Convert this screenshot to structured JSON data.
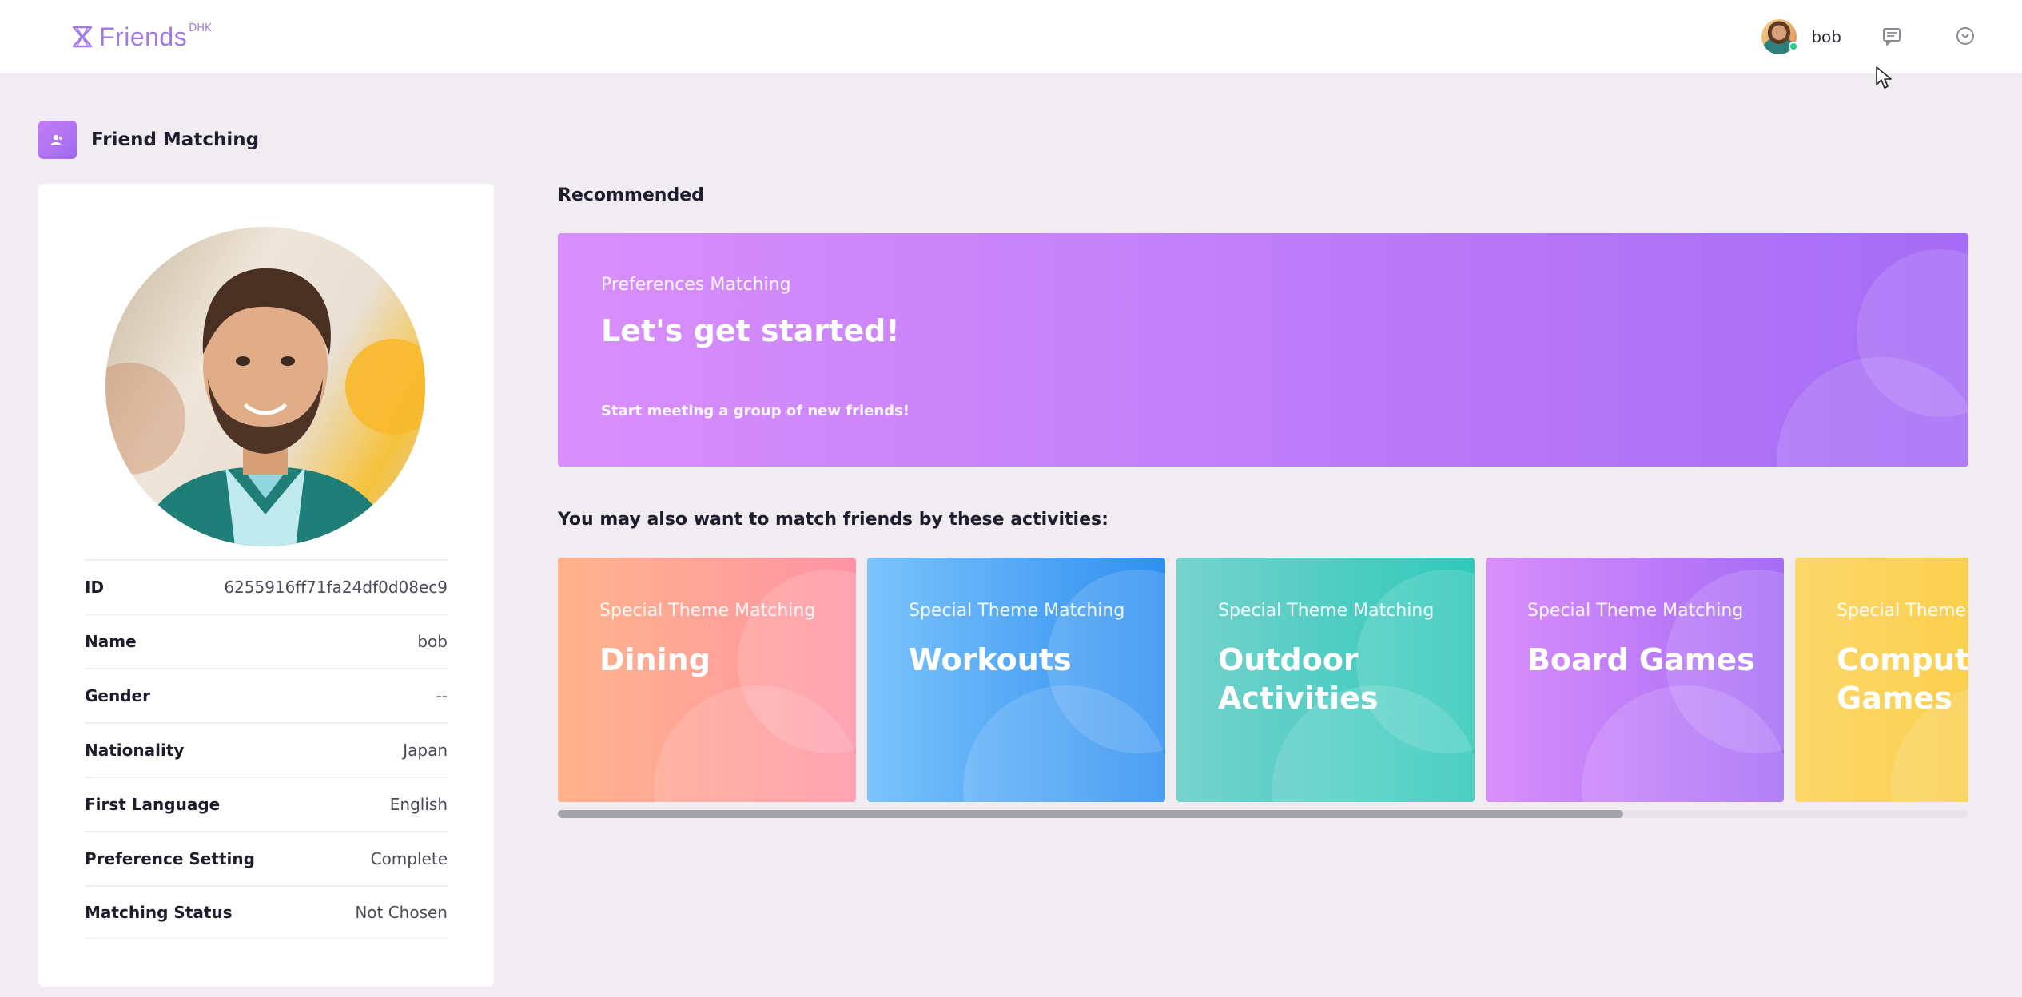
{
  "header": {
    "logo_text": "Friends",
    "logo_sup": "DHK",
    "user_name": "bob"
  },
  "page": {
    "title": "Friend Matching"
  },
  "profile": {
    "rows": [
      {
        "label": "ID",
        "value": "6255916ff71fa24df0d08ec9"
      },
      {
        "label": "Name",
        "value": "bob"
      },
      {
        "label": "Gender",
        "value": "--"
      },
      {
        "label": "Nationality",
        "value": "Japan"
      },
      {
        "label": "First Language",
        "value": "English"
      },
      {
        "label": "Preference Setting",
        "value": "Complete"
      },
      {
        "label": "Matching Status",
        "value": "Not Chosen"
      }
    ]
  },
  "recommended": {
    "heading": "Recommended",
    "eyebrow": "Preferences Matching",
    "title": "Let's get started!",
    "subtitle": "Start meeting a group of new friends!",
    "colors": [
      "#d98ffb",
      "#a56cf5"
    ]
  },
  "activities": {
    "heading": "You may also want to match friends by these activities:",
    "cards": [
      {
        "eyebrow": "Special Theme Matching",
        "title": "Dining",
        "colors": [
          "#ffb38a",
          "#ff94a6"
        ]
      },
      {
        "eyebrow": "Special Theme Matching",
        "title": "Workouts",
        "colors": [
          "#7cc3fb",
          "#2f8ff0"
        ]
      },
      {
        "eyebrow": "Special Theme Matching",
        "title": "Outdoor Activities",
        "colors": [
          "#77d2cd",
          "#2fc9b9"
        ]
      },
      {
        "eyebrow": "Special Theme Matching",
        "title": "Board Games",
        "colors": [
          "#d98ffb",
          "#a56cf5"
        ]
      },
      {
        "eyebrow": "Special Theme Matching",
        "title": "Computer Games",
        "colors": [
          "#fcd86b",
          "#f9c93a"
        ]
      }
    ],
    "scroll_fraction": 0.755
  },
  "icons": {
    "logo": "hourglass-logo-icon",
    "message": "message-icon",
    "dropdown": "chevron-circle-icon",
    "page": "friends-icon",
    "cursor": "mouse-pointer-icon"
  }
}
